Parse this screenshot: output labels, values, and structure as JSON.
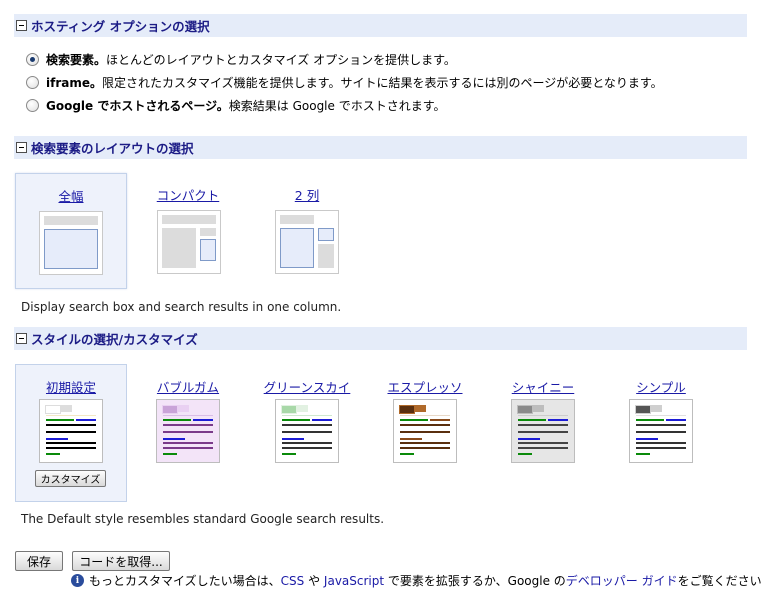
{
  "hosting": {
    "title": "ホスティング オプションの選択",
    "options": [
      {
        "label": "検索要素。",
        "desc": "ほとんどのレイアウトとカスタマイズ オプションを提供します。",
        "checked": true
      },
      {
        "label": "iframe。",
        "desc": "限定されたカスタマイズ機能を提供します。サイトに結果を表示するには別のページが必要となります。",
        "checked": false
      },
      {
        "label": "Google でホストされるページ。",
        "desc": "検索結果は Google でホストされます。",
        "checked": false
      }
    ]
  },
  "layout": {
    "title": "検索要素のレイアウトの選択",
    "items": [
      {
        "label": "全幅",
        "selected": true
      },
      {
        "label": "コンパクト",
        "selected": false
      },
      {
        "label": "2 列",
        "selected": false
      }
    ],
    "description": "Display search box and search results in one column."
  },
  "style": {
    "title": "スタイルの選択/カスタマイズ",
    "items": [
      {
        "label": "初期設定",
        "selected": true,
        "colors": {
          "bg": "#ffffff",
          "tab1": "#ffffff",
          "tab2": "#dddddd",
          "accent": "#f2e8c4",
          "line1": "#1c1cd6",
          "line2": "#000000",
          "url": "#0a8a0a"
        }
      },
      {
        "label": "バブルガム",
        "selected": false,
        "colors": {
          "bg": "#f3e4f8",
          "tab1": "#c9a3d8",
          "tab2": "#e9d0f2",
          "accent": "#d9bde6",
          "line1": "#1c1cd6",
          "line2": "#7a3a8a",
          "url": "#0a8a0a"
        }
      },
      {
        "label": "グリーンスカイ",
        "selected": false,
        "colors": {
          "bg": "#ffffff",
          "tab1": "#a8d8a8",
          "tab2": "#e2f1e2",
          "accent": "#cfe8cf",
          "line1": "#1c1cd6",
          "line2": "#333333",
          "url": "#0a8a0a"
        }
      },
      {
        "label": "エスプレッソ",
        "selected": false,
        "colors": {
          "bg": "#ffffff",
          "tab1": "#5a2f0e",
          "tab2": "#b06a2a",
          "accent": "#e8d9c8",
          "line1": "#8a4a1a",
          "line2": "#5a2f0e",
          "url": "#0a8a0a"
        }
      },
      {
        "label": "シャイニー",
        "selected": false,
        "colors": {
          "bg": "#e6e6e6",
          "tab1": "#8a8a8a",
          "tab2": "#bdbdbd",
          "accent": "#cccccc",
          "line1": "#1c1cd6",
          "line2": "#444444",
          "url": "#0a8a0a"
        }
      },
      {
        "label": "シンプル",
        "selected": false,
        "colors": {
          "bg": "#ffffff",
          "tab1": "#555555",
          "tab2": "#cfcfcf",
          "accent": "#e0e0e0",
          "line1": "#1c1cd6",
          "line2": "#333333",
          "url": "#0a8a0a"
        }
      }
    ],
    "customize_label": "カスタマイズ",
    "description": "The Default style resembles standard Google search results."
  },
  "actions": {
    "save_label": "保存",
    "get_code_label": "コードを取得..."
  },
  "info": {
    "icon": "info-icon",
    "text1": "もっとカスタマイズしたい場合は、",
    "css_link": "CSS",
    "text2": " や ",
    "js_link": "JavaScript",
    "text3": " で要素を拡張するか、Google の",
    "guide_link": "デベロッパー ガイド",
    "text4": "をご覧ください。"
  }
}
